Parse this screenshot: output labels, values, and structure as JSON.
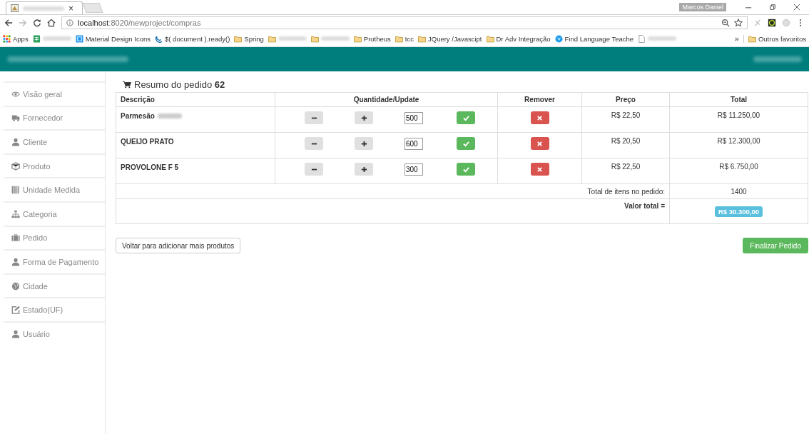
{
  "browser": {
    "tab_close": "×",
    "address_host": "localhost",
    "address_path": ":8020/newproject/compras",
    "profile": "Marcos Daniel",
    "bookmarks": [
      {
        "kind": "apps",
        "label": "Apps"
      },
      {
        "kind": "sheet"
      },
      {
        "kind": "mdi",
        "label": "Material Design Icons"
      },
      {
        "kind": "jquery",
        "label": "$( document ).ready()"
      },
      {
        "kind": "folder",
        "label": "Spring"
      },
      {
        "kind": "folder"
      },
      {
        "kind": "folder"
      },
      {
        "kind": "folder",
        "label": "Protheus"
      },
      {
        "kind": "folder",
        "label": "tcc"
      },
      {
        "kind": "folder",
        "label": "JQuery /Javascipt"
      },
      {
        "kind": "folder",
        "label": "Dr Adv Integração"
      },
      {
        "kind": "globe",
        "label": "Find Language Teache"
      },
      {
        "kind": "page"
      }
    ],
    "more": "»",
    "other_bookmarks": "Outros favoritos"
  },
  "sidebar": {
    "items": [
      {
        "kind": "eye",
        "label": "Visão geral"
      },
      {
        "kind": "truck",
        "label": "Fornecedor"
      },
      {
        "kind": "user",
        "label": "Cliente"
      },
      {
        "kind": "box",
        "label": "Produto"
      },
      {
        "kind": "barcode",
        "label": "Unidade Medida"
      },
      {
        "kind": "tree",
        "label": "Categoria"
      },
      {
        "kind": "bag",
        "label": "Pedido"
      },
      {
        "kind": "user",
        "label": "Forma de Pagamento"
      },
      {
        "kind": "globe",
        "label": "Cidade"
      },
      {
        "kind": "edit",
        "label": "Estado(UF)"
      },
      {
        "kind": "person",
        "label": "Usuário"
      }
    ]
  },
  "order": {
    "title": "Resumo do pedido",
    "number": "62",
    "columns": [
      "Descrição",
      "Quantidade/Update",
      "Remover",
      "Preço",
      "Total"
    ],
    "rows": [
      {
        "description": "Parmesão",
        "quantity": "500",
        "price": "R$ 22,50",
        "total": "R$ 11.250,00"
      },
      {
        "description": "QUEIJO PRATO",
        "quantity": "600",
        "price": "R$ 20,50",
        "total": "R$ 12.300,00"
      },
      {
        "description": "PROVOLONE F 5",
        "quantity": "300",
        "price": "R$ 22,50",
        "total": "R$ 6.750,00"
      }
    ],
    "items_label": "Total de itens no pedido:",
    "items_value": "1400",
    "total_label": "Valor total =",
    "total_value": "R$ 30.300,00",
    "back_button": "Voltar para adicionar mais produtos",
    "finish_button": "Finalizar Pedido"
  }
}
